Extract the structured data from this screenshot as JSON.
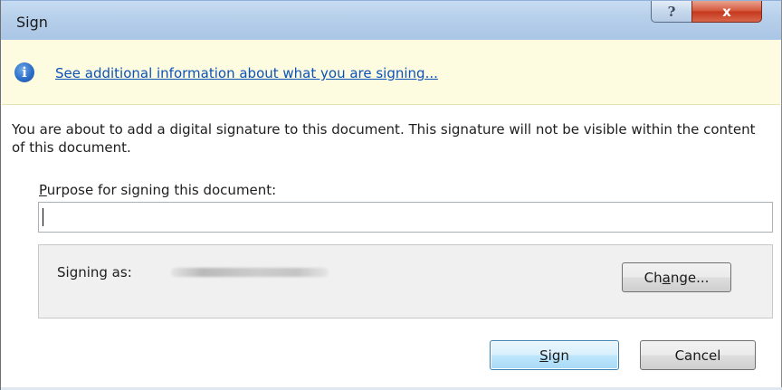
{
  "window": {
    "title": "Sign",
    "help_glyph": "?",
    "close_glyph": "x"
  },
  "infobar": {
    "icon": "info-icon",
    "icon_glyph": "i",
    "link_text": "See additional information about what you are signing..."
  },
  "description": "You are about to add a digital signature to this document. This signature will not be visible within the content of this document.",
  "purpose": {
    "label_mnemonic": "P",
    "label_rest": "urpose for signing this document:",
    "value": ""
  },
  "signing": {
    "label": "Signing as:",
    "change_before": "Ch",
    "change_mnemonic": "a",
    "change_after": "nge..."
  },
  "buttons": {
    "sign_mnemonic": "S",
    "sign_rest": "ign",
    "cancel": "Cancel"
  },
  "colors": {
    "link": "#0b52b9",
    "infobar_bg": "#fdfbe0",
    "close_button": "#c5381e",
    "default_button_border": "#3c7fb1"
  }
}
